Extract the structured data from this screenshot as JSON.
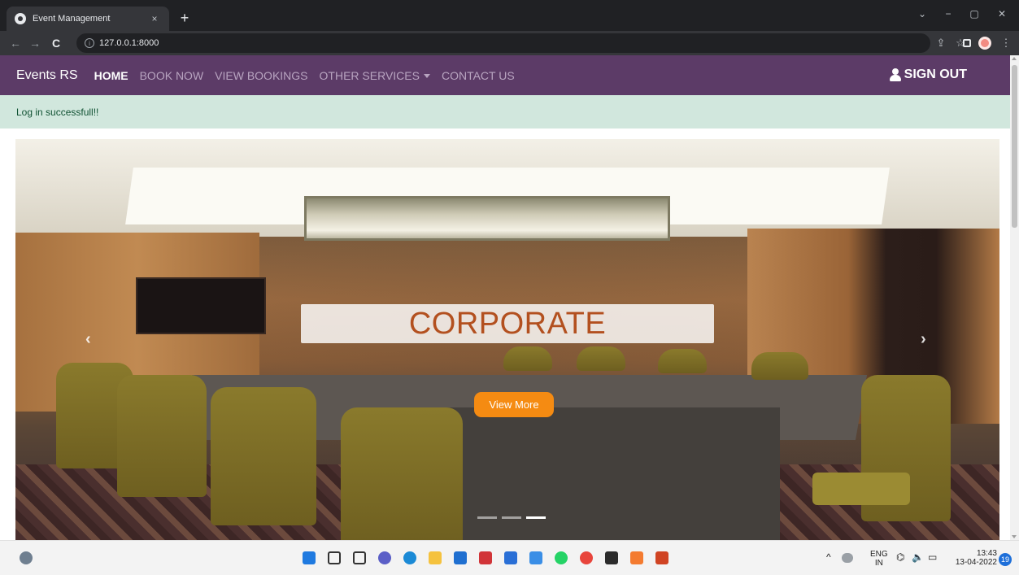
{
  "browser": {
    "tab_title": "Event Management",
    "tab_close": "×",
    "new_tab": "+",
    "url": "127.0.0.1:8000",
    "info_glyph": "i",
    "back": "←",
    "forward": "→",
    "reload": "C",
    "share_icon": "⇪",
    "star_icon": "☆",
    "menu_icon": "⋮",
    "min": "⌄",
    "minimize": "−",
    "maximize": "▢",
    "close": "✕"
  },
  "site": {
    "brand": "Events RS",
    "nav": [
      "HOME",
      "BOOK NOW",
      "VIEW BOOKINGS",
      "OTHER SERVICES",
      "CONTACT US"
    ],
    "sign_out": "SIGN OUT",
    "alert": "Log in successfull!!"
  },
  "carousel": {
    "caption": "CORPORATE",
    "button": "View More",
    "prev": "‹",
    "next": "›",
    "slide_count": 3,
    "active_slide": 3
  },
  "taskbar": {
    "lang_top": "ENG",
    "lang_bottom": "IN",
    "time": "13:43",
    "date": "13-04-2022",
    "notifications": "19",
    "chevron": "^",
    "apps": [
      {
        "name": "windows-start",
        "color": "#1f7ae0"
      },
      {
        "name": "search",
        "color": "#333333"
      },
      {
        "name": "task-view",
        "color": "#333333"
      },
      {
        "name": "chat",
        "color": "#5b5fc7"
      },
      {
        "name": "edge",
        "color": "#1b8ad6"
      },
      {
        "name": "file-explorer",
        "color": "#f5c23e"
      },
      {
        "name": "store",
        "color": "#1f6fd0"
      },
      {
        "name": "app-red",
        "color": "#d13438"
      },
      {
        "name": "mail",
        "color": "#2a6fd6"
      },
      {
        "name": "notepad",
        "color": "#3a8ee6"
      },
      {
        "name": "whatsapp",
        "color": "#25d366"
      },
      {
        "name": "chrome",
        "color": "#e8453c"
      },
      {
        "name": "terminal",
        "color": "#2b2b2b"
      },
      {
        "name": "xampp",
        "color": "#f47b30"
      },
      {
        "name": "powerpoint",
        "color": "#d04423"
      }
    ]
  }
}
